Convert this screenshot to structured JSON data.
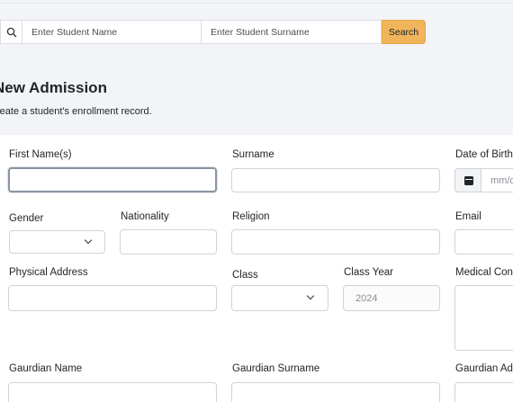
{
  "search": {
    "first_placeholder": "Enter Student Name",
    "second_placeholder": "Enter Student Surname",
    "button_label": "Search",
    "icon": "search-icon"
  },
  "header": {
    "title": "New Admission",
    "subtitle": "reate a student's enrollment record."
  },
  "form": {
    "first_names_label": "First Name(s)",
    "surname_label": "Surname",
    "dob_label": "Date of Birth",
    "dob_placeholder": "mm/d",
    "gender_label": "Gender",
    "nationality_label": "Nationality",
    "religion_label": "Religion",
    "email_label": "Email",
    "address_label": "Physical Address",
    "class_label": "Class",
    "class_year_label": "Class Year",
    "class_year_value": "2024",
    "medical_label": "Medical Con",
    "guardian_name_label": "Gaurdian Name",
    "guardian_surname_label": "Gaurdian Surname",
    "guardian_address_label": "Gaurdian Ad",
    "icons": [
      "calendar-icon",
      "chevron-down-icon"
    ]
  },
  "colors": {
    "accent": "#f0b45a",
    "band": "#f3f4f7",
    "border": "#ced4da"
  }
}
